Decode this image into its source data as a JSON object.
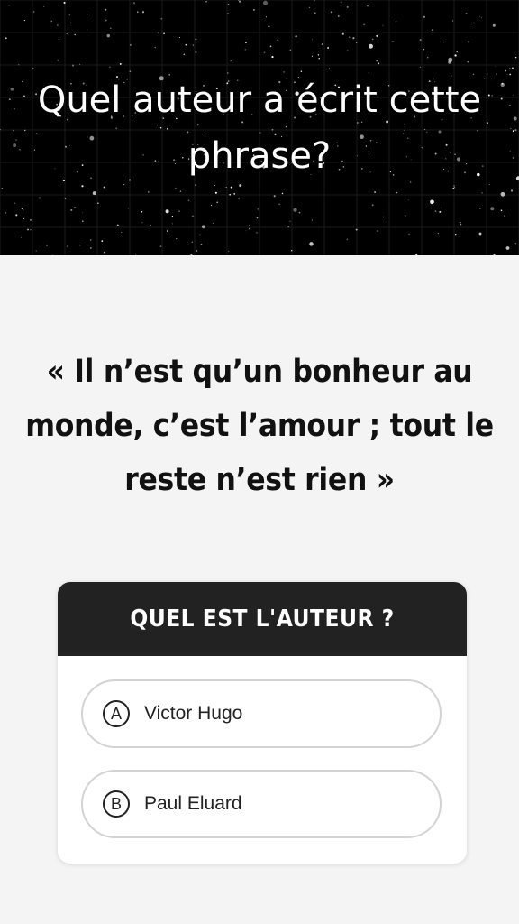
{
  "header": {
    "title": "Quel auteur a écrit cette phrase?"
  },
  "quote": {
    "text": "« Il n’est qu’un bonheur au monde, c’est l’amour ; tout le reste n’est rien »"
  },
  "quiz": {
    "heading": "QUEL EST L'AUTEUR ?",
    "options": [
      {
        "letter": "A",
        "label": "Victor Hugo"
      },
      {
        "letter": "B",
        "label": "Paul Eluard"
      }
    ]
  },
  "colors": {
    "background": "#f4f4f4",
    "header_bg": "#000000",
    "card_header_bg": "#222222",
    "option_border": "#d3d3d3"
  }
}
